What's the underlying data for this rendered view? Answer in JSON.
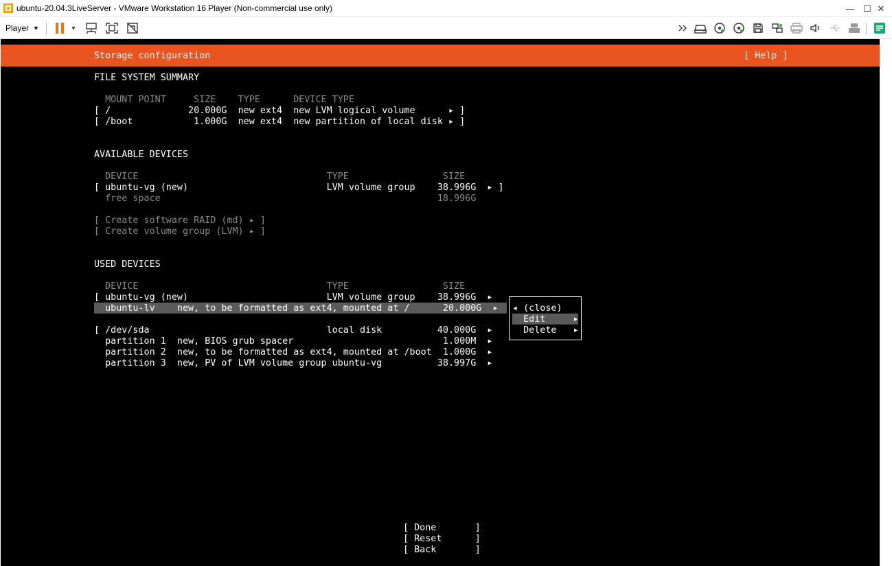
{
  "window": {
    "title": "ubuntu-20.04.3LiveServer - VMware Workstation 16 Player (Non-commercial use only)",
    "minimize_glyph": "—",
    "maximize_glyph": "☐",
    "close_glyph": "✕"
  },
  "toolbar": {
    "player_label": "Player",
    "player_caret": "▼",
    "pause_caret": "▼"
  },
  "installer": {
    "header_title": "Storage configuration",
    "help_label": "[ Help ]",
    "fs_summary": {
      "title": "FILE SYSTEM SUMMARY",
      "header": "  MOUNT POINT     SIZE    TYPE      DEVICE TYPE",
      "rows": [
        "[ /              20.000G  new ext4  new LVM logical volume      ▸ ]",
        "[ /boot           1.000G  new ext4  new partition of local disk ▸ ]"
      ]
    },
    "available_devices": {
      "title": "AVAILABLE DEVICES",
      "header": "  DEVICE                                  TYPE                 SIZE",
      "rows": [
        "[ ubuntu-vg (new)                         LVM volume group    38.996G  ▸ ]"
      ],
      "free_space": "  free space                                                  18.996G",
      "actions": [
        "[ Create software RAID (md) ▸ ]",
        "[ Create volume group (LVM) ▸ ]"
      ]
    },
    "used_devices": {
      "title": "USED DEVICES",
      "header": "  DEVICE                                  TYPE                 SIZE",
      "rows": [
        "[ ubuntu-vg (new)                         LVM volume group    38.996G  ▸",
        "  ubuntu-lv    new, to be formatted as ext4, mounted at /      20.000G  ▸",
        "",
        "[ /dev/sda                                local disk          40.000G  ▸",
        "  partition 1  new, BIOS grub spacer                           1.000M  ▸",
        "  partition 2  new, to be formatted as ext4, mounted at /boot  1.000G  ▸",
        "  partition 3  new, PV of LVM volume group ubuntu-vg          38.997G  ▸"
      ]
    },
    "context_menu": {
      "items": [
        "◂ (close)",
        "  Edit     ▸",
        "  Delete   ▸"
      ]
    },
    "footer_buttons": [
      "[ Done       ]",
      "[ Reset      ]",
      "[ Back       ]"
    ]
  }
}
